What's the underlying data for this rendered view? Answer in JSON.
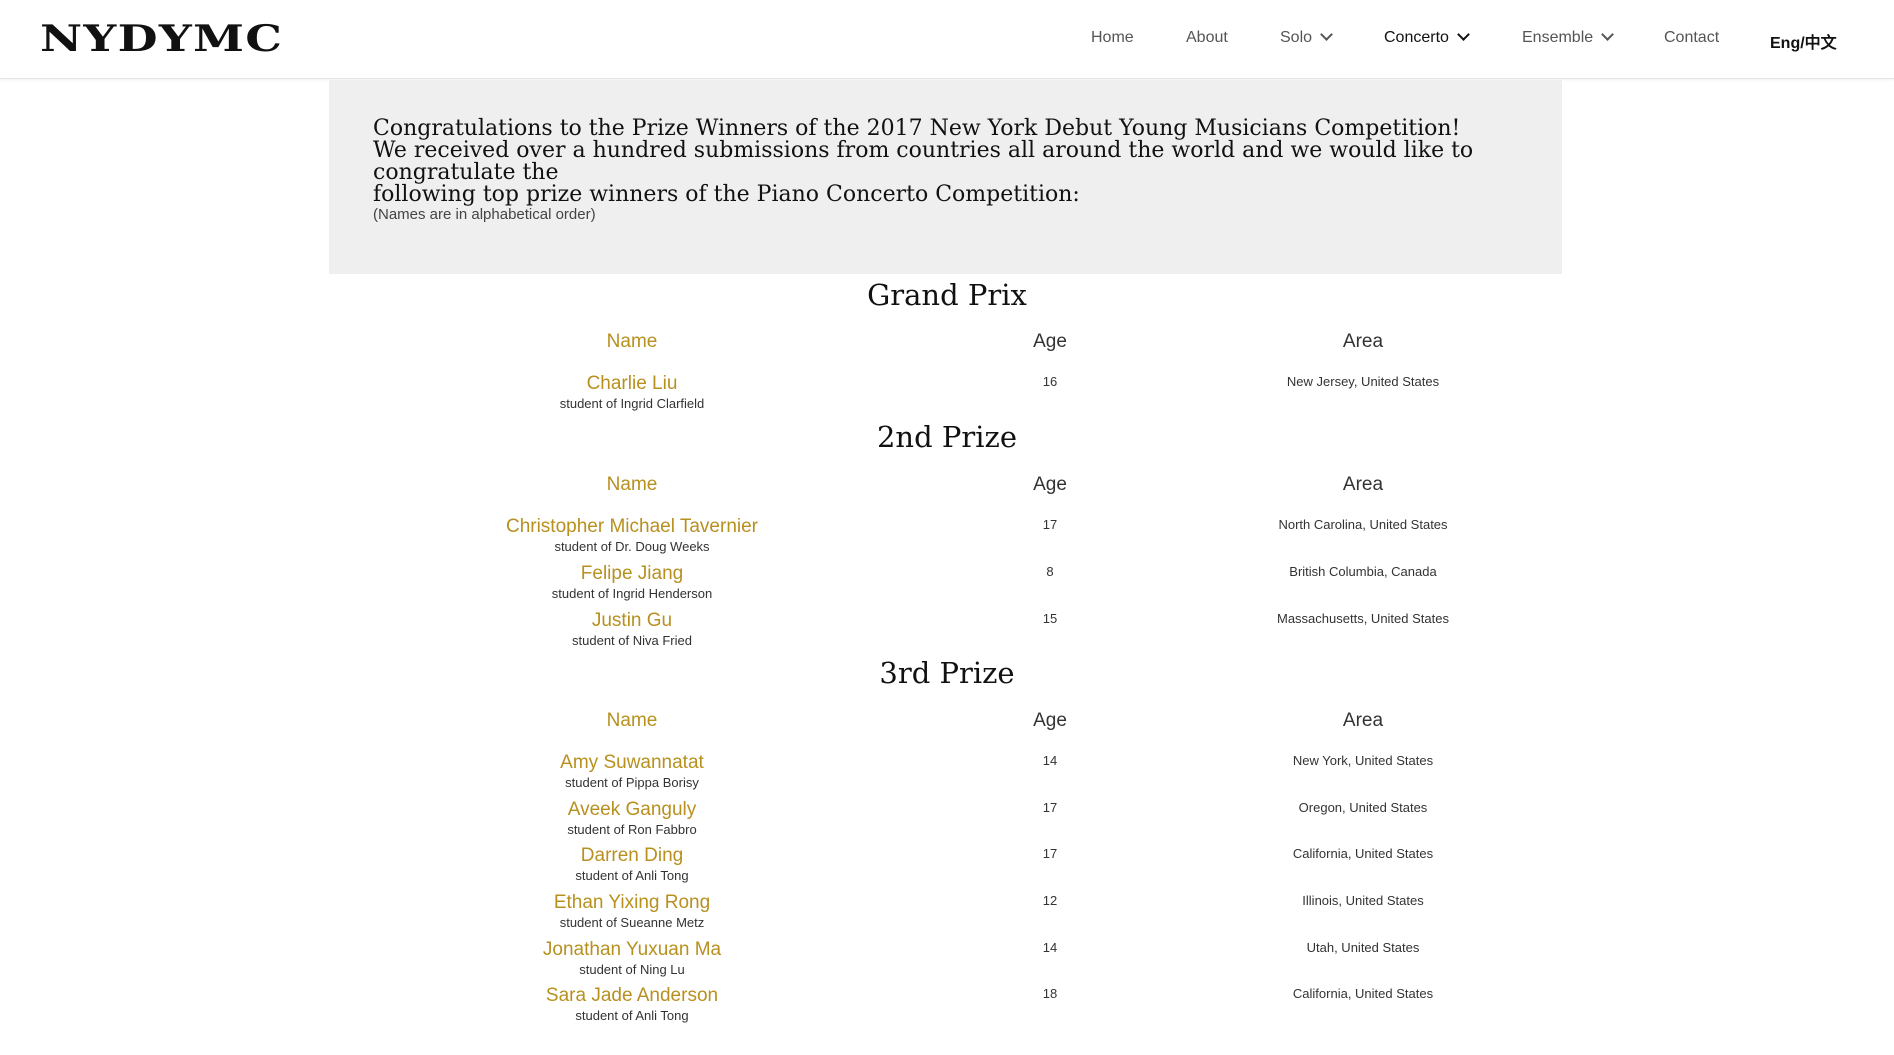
{
  "header": {
    "logo_text": "NYDYMC",
    "nav": {
      "home": "Home",
      "about": "About",
      "solo": "Solo",
      "concerto": "Concerto",
      "ensemble": "Ensemble",
      "contact": "Contact",
      "lang": "Eng/中文"
    }
  },
  "intro": {
    "line1": "Congratulations to the Prize Winners of the 2017 New York Debut Young Musicians Competition!",
    "line2": "We received over a hundred submissions from countries all around the world and we would like to congratulate the",
    "line3": "following top prize winners of the Piano Concerto Competition:",
    "note": "(Names are in alphabetical order)"
  },
  "columns": {
    "name": "Name",
    "age": "Age",
    "area": "Area"
  },
  "sections": [
    {
      "title": "Grand Prix",
      "rows": [
        {
          "name": "Charlie Liu",
          "teacher": "student of Ingrid Clarfield",
          "age": "16",
          "area": "New Jersey, United States"
        }
      ]
    },
    {
      "title": "2nd Prize",
      "rows": [
        {
          "name": "Christopher Michael Tavernier",
          "teacher": "student of Dr. Doug Weeks",
          "age": "17",
          "area": "North Carolina, United States"
        },
        {
          "name": "Felipe Jiang",
          "teacher": "student of Ingrid Henderson",
          "age": "8",
          "area": "British Columbia, Canada"
        },
        {
          "name": "Justin Gu",
          "teacher": "student of Niva Fried",
          "age": "15",
          "area": "Massachusetts, United States"
        }
      ]
    },
    {
      "title": "3rd Prize",
      "rows": [
        {
          "name": "Amy Suwannatat",
          "teacher": "student of Pippa Borisy",
          "age": "14",
          "area": "New York, United States"
        },
        {
          "name": "Aveek Ganguly",
          "teacher": "student of Ron Fabbro",
          "age": "17",
          "area": "Oregon, United States"
        },
        {
          "name": "Darren Ding",
          "teacher": "student of Anli Tong",
          "age": "17",
          "area": "California, United States"
        },
        {
          "name": "Ethan Yixing Rong",
          "teacher": "student of Sueanne Metz",
          "age": "12",
          "area": "Illinois, United States"
        },
        {
          "name": "Jonathan Yuxuan Ma",
          "teacher": "student of Ning Lu",
          "age": "14",
          "area": "Utah, United States"
        },
        {
          "name": "Sara Jade Anderson",
          "teacher": "student of Anli Tong",
          "age": "18",
          "area": "California, United States"
        }
      ]
    }
  ],
  "colors": {
    "accent_gold": "#b8901f",
    "intro_bg": "#efefef"
  }
}
